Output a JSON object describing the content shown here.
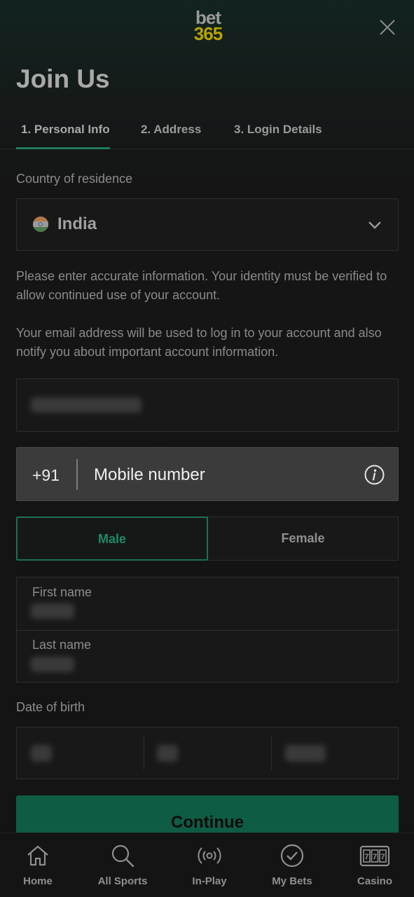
{
  "header": {
    "logo_line1": "bet",
    "logo_line2": "365",
    "title": "Join Us"
  },
  "tabs": [
    {
      "label": "1. Personal Info",
      "active": true
    },
    {
      "label": "2. Address",
      "active": false
    },
    {
      "label": "3. Login Details",
      "active": false
    }
  ],
  "form": {
    "country_label": "Country of residence",
    "country_value": "India",
    "info_text_1": "Please enter accurate information. Your identity must be verified to allow continued use of your account.",
    "info_text_2": "Your email address will be used to log in to your account and also notify you about important account information.",
    "phone_code": "+91",
    "phone_placeholder": "Mobile number",
    "gender_options": [
      "Male",
      "Female"
    ],
    "gender_selected": "Male",
    "first_name_label": "First name",
    "last_name_label": "Last name",
    "dob_label": "Date of birth",
    "continue_label": "Continue"
  },
  "bottom_nav": [
    {
      "label": "Home",
      "icon": "home-icon"
    },
    {
      "label": "All Sports",
      "icon": "search-icon"
    },
    {
      "label": "In-Play",
      "icon": "live-broadcast-icon"
    },
    {
      "label": "My Bets",
      "icon": "check-circle-icon"
    },
    {
      "label": "Casino",
      "icon": "slot-machine-icon"
    }
  ],
  "colors": {
    "accent": "#1f7a5d",
    "continue_bg": "#0f5c44",
    "logo_yellow": "#b8a300"
  }
}
